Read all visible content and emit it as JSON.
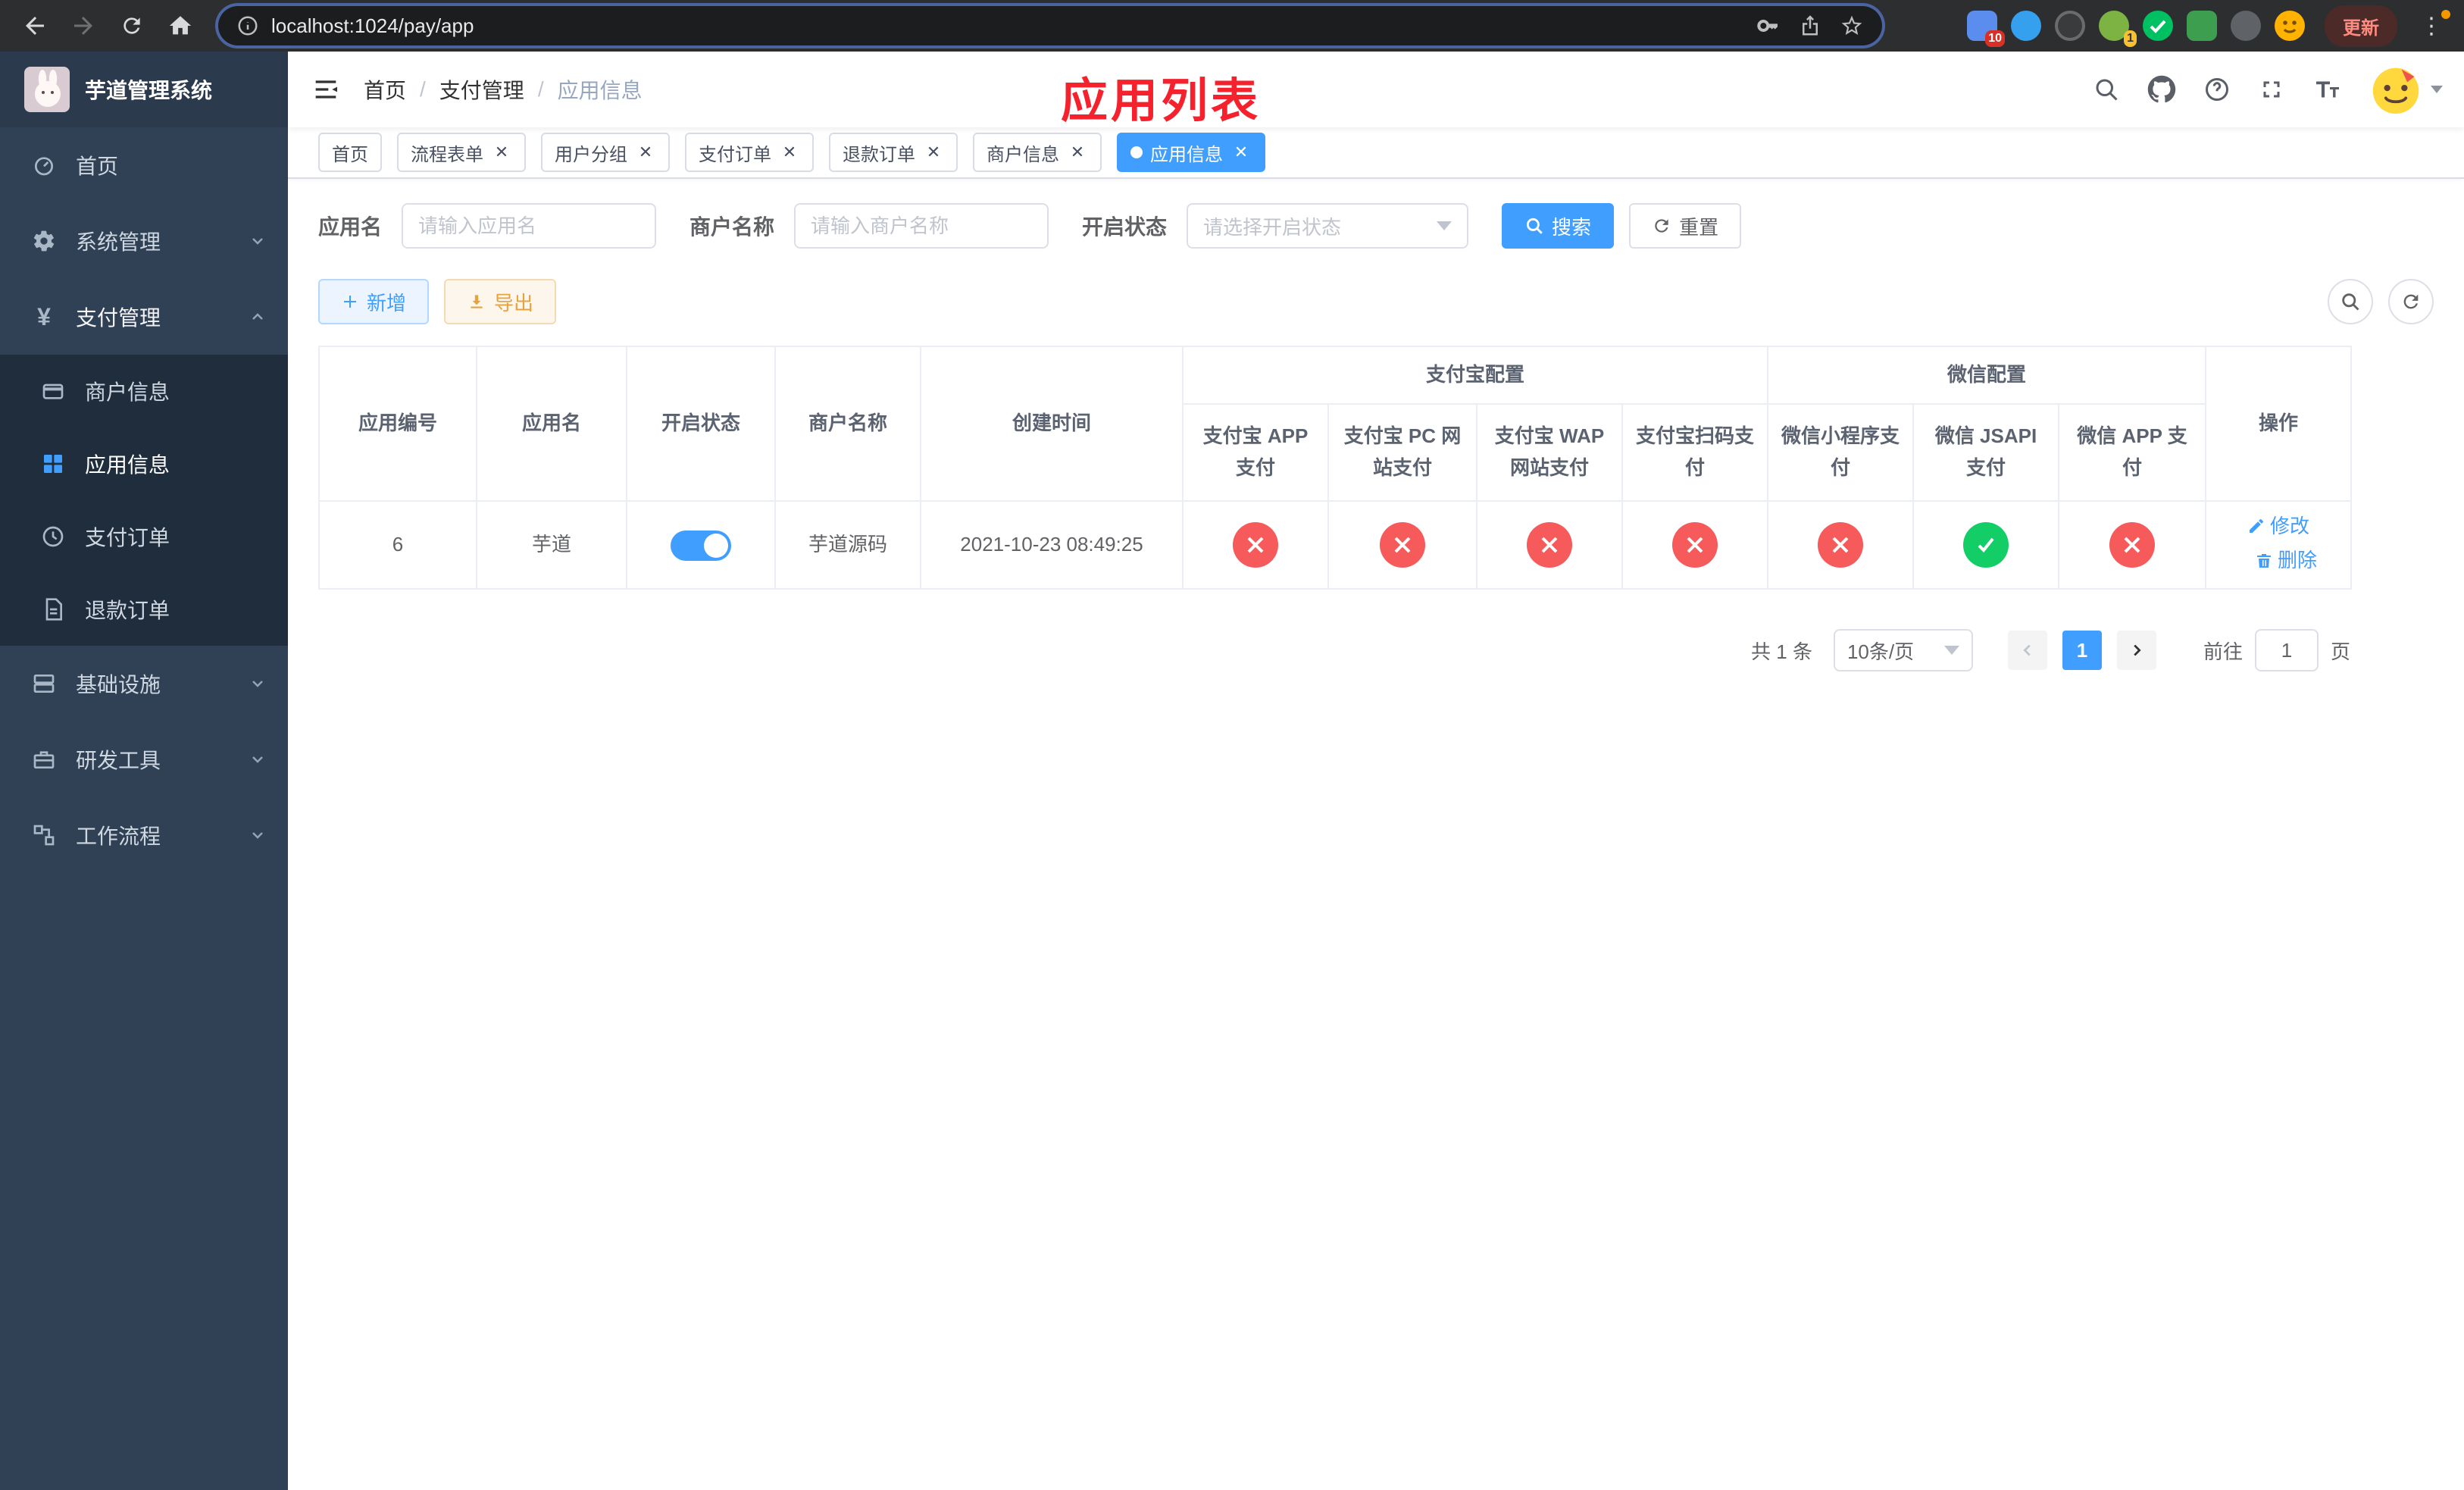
{
  "browser": {
    "url": "localhost:1024/pay/app",
    "update_label": "更新",
    "ext_badge_tabs": "10",
    "ext_badge_avatar": "1"
  },
  "sidebar": {
    "title": "芋道管理系统",
    "items": [
      {
        "label": "首页"
      },
      {
        "label": "系统管理"
      },
      {
        "label": "支付管理"
      },
      {
        "label": "商户信息"
      },
      {
        "label": "应用信息"
      },
      {
        "label": "支付订单"
      },
      {
        "label": "退款订单"
      },
      {
        "label": "基础设施"
      },
      {
        "label": "研发工具"
      },
      {
        "label": "工作流程"
      }
    ]
  },
  "header": {
    "breadcrumb": [
      {
        "label": "首页"
      },
      {
        "label": "支付管理"
      },
      {
        "label": "应用信息"
      }
    ],
    "page_title": "应用列表",
    "title_color": "#f5222d"
  },
  "tabs": [
    {
      "label": "首页",
      "closable": false,
      "active": false
    },
    {
      "label": "流程表单",
      "closable": true,
      "active": false
    },
    {
      "label": "用户分组",
      "closable": true,
      "active": false
    },
    {
      "label": "支付订单",
      "closable": true,
      "active": false
    },
    {
      "label": "退款订单",
      "closable": true,
      "active": false
    },
    {
      "label": "商户信息",
      "closable": true,
      "active": false
    },
    {
      "label": "应用信息",
      "closable": true,
      "active": true
    }
  ],
  "filters": {
    "app_name_label": "应用名",
    "app_name_placeholder": "请输入应用名",
    "merchant_label": "商户名称",
    "merchant_placeholder": "请输入商户名称",
    "status_label": "开启状态",
    "status_placeholder": "请选择开启状态",
    "search_label": "搜索",
    "reset_label": "重置"
  },
  "toolbar": {
    "add_label": "新增",
    "export_label": "导出"
  },
  "table": {
    "columns": {
      "app_id": "应用编号",
      "app_name": "应用名",
      "status": "开启状态",
      "merchant": "商户名称",
      "created": "创建时间",
      "alipay_group": "支付宝配置",
      "wechat_group": "微信配置",
      "alipay_app": "支付宝 APP 支付",
      "alipay_pc": "支付宝 PC 网站支付",
      "alipay_wap": "支付宝 WAP 网站支付",
      "alipay_qr": "支付宝扫码支付",
      "wechat_mini": "微信小程序支付",
      "wechat_jsapi": "微信 JSAPI 支付",
      "wechat_app": "微信 APP 支付",
      "actions": "操作"
    },
    "rows": [
      {
        "app_id": "6",
        "app_name": "芋道",
        "status_on": true,
        "merchant": "芋道源码",
        "created": "2021-10-23 08:49:25",
        "alipay_app": false,
        "alipay_pc": false,
        "alipay_wap": false,
        "alipay_qr": false,
        "wechat_mini": false,
        "wechat_jsapi": true,
        "wechat_app": false,
        "edit_label": "修改",
        "delete_label": "删除"
      }
    ]
  },
  "pagination": {
    "total": "共 1 条",
    "page_size": "10条/页",
    "current_page": "1",
    "goto_label": "前往",
    "goto_value": "1",
    "unit_label": "页"
  },
  "colors": {
    "primary": "#409eff",
    "success": "#13ce66",
    "danger": "#f65a5a",
    "sidebar_bg": "#304156",
    "submenu_bg": "#1f2d3d",
    "title_red": "#f5222d"
  }
}
